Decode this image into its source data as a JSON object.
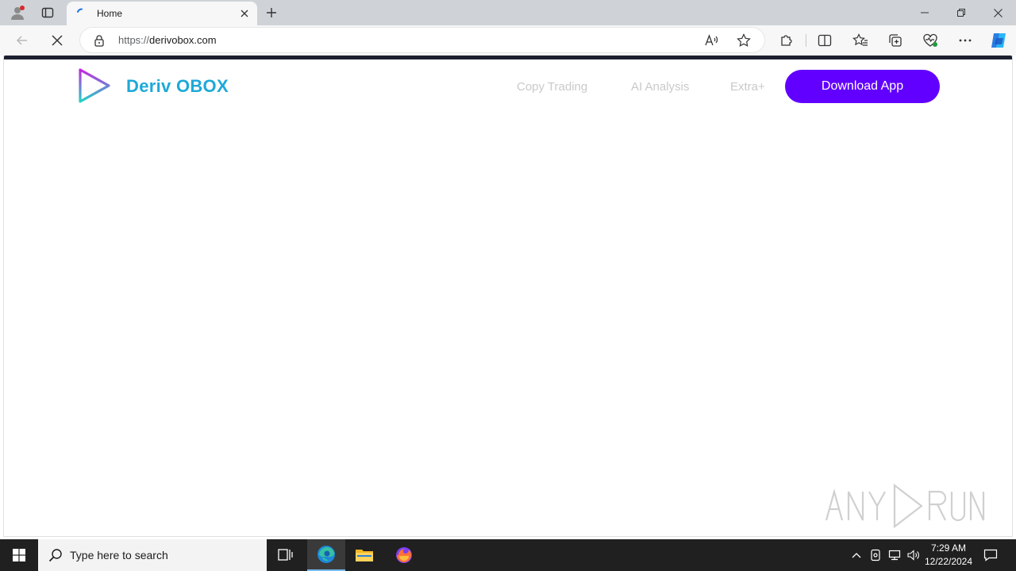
{
  "browser": {
    "tab": {
      "title": "Home"
    },
    "address_bar": {
      "protocol": "https://",
      "host": "derivobox.com"
    }
  },
  "page": {
    "brand": "Deriv OBOX",
    "nav": [
      {
        "label": "Copy Trading"
      },
      {
        "label": "AI Analysis"
      },
      {
        "label": "Extra+"
      }
    ],
    "cta_label": "Download App",
    "watermark": "ANY RUN"
  },
  "taskbar": {
    "search_placeholder": "Type here to search",
    "time": "7:29 AM",
    "date": "12/22/2024"
  },
  "colors": {
    "brand_text": "#1ea9d8",
    "cta_bg": "#6200ff",
    "nav_text": "#c9c9c9",
    "taskbar_bg": "#202020"
  },
  "icons": {
    "profile": "profile-icon",
    "tab_actions": "tab-actions-icon",
    "favicon": "loading-favicon-icon",
    "read_aloud": "read-aloud-icon",
    "favorite": "star-icon",
    "extensions": "puzzle-icon",
    "split_screen": "split-screen-icon",
    "favorites": "favorites-icon",
    "collections": "collections-icon",
    "browser_essentials": "heart-pulse-icon",
    "more": "ellipsis-icon",
    "copilot": "copilot-icon"
  }
}
